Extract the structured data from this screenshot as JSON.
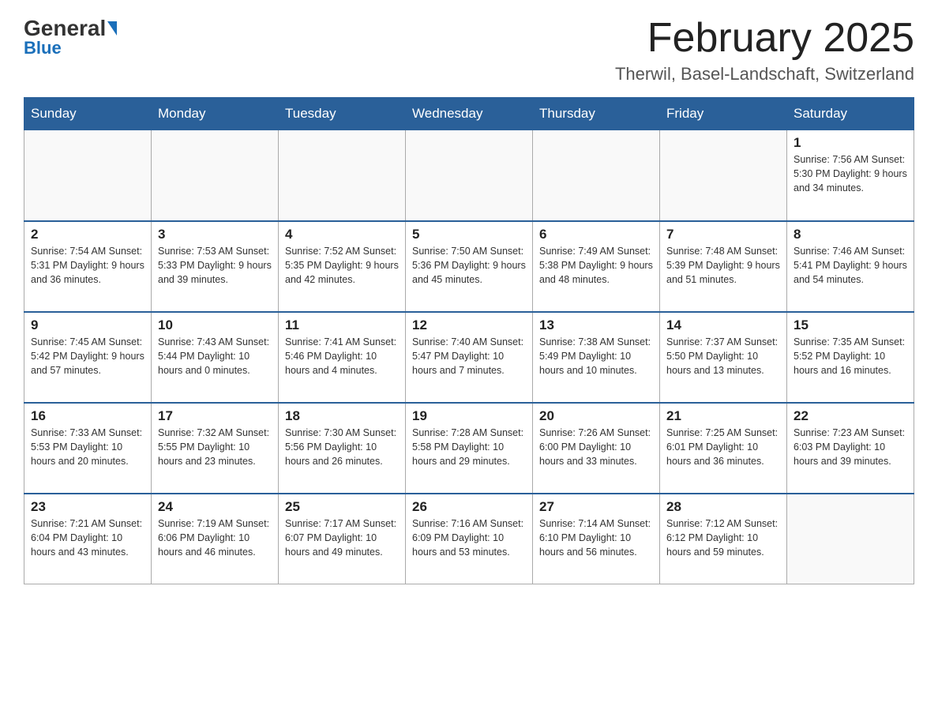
{
  "logo": {
    "general": "General",
    "blue": "Blue"
  },
  "title": "February 2025",
  "location": "Therwil, Basel-Landschaft, Switzerland",
  "headers": [
    "Sunday",
    "Monday",
    "Tuesday",
    "Wednesday",
    "Thursday",
    "Friday",
    "Saturday"
  ],
  "weeks": [
    [
      {
        "day": "",
        "info": ""
      },
      {
        "day": "",
        "info": ""
      },
      {
        "day": "",
        "info": ""
      },
      {
        "day": "",
        "info": ""
      },
      {
        "day": "",
        "info": ""
      },
      {
        "day": "",
        "info": ""
      },
      {
        "day": "1",
        "info": "Sunrise: 7:56 AM\nSunset: 5:30 PM\nDaylight: 9 hours and 34 minutes."
      }
    ],
    [
      {
        "day": "2",
        "info": "Sunrise: 7:54 AM\nSunset: 5:31 PM\nDaylight: 9 hours and 36 minutes."
      },
      {
        "day": "3",
        "info": "Sunrise: 7:53 AM\nSunset: 5:33 PM\nDaylight: 9 hours and 39 minutes."
      },
      {
        "day": "4",
        "info": "Sunrise: 7:52 AM\nSunset: 5:35 PM\nDaylight: 9 hours and 42 minutes."
      },
      {
        "day": "5",
        "info": "Sunrise: 7:50 AM\nSunset: 5:36 PM\nDaylight: 9 hours and 45 minutes."
      },
      {
        "day": "6",
        "info": "Sunrise: 7:49 AM\nSunset: 5:38 PM\nDaylight: 9 hours and 48 minutes."
      },
      {
        "day": "7",
        "info": "Sunrise: 7:48 AM\nSunset: 5:39 PM\nDaylight: 9 hours and 51 minutes."
      },
      {
        "day": "8",
        "info": "Sunrise: 7:46 AM\nSunset: 5:41 PM\nDaylight: 9 hours and 54 minutes."
      }
    ],
    [
      {
        "day": "9",
        "info": "Sunrise: 7:45 AM\nSunset: 5:42 PM\nDaylight: 9 hours and 57 minutes."
      },
      {
        "day": "10",
        "info": "Sunrise: 7:43 AM\nSunset: 5:44 PM\nDaylight: 10 hours and 0 minutes."
      },
      {
        "day": "11",
        "info": "Sunrise: 7:41 AM\nSunset: 5:46 PM\nDaylight: 10 hours and 4 minutes."
      },
      {
        "day": "12",
        "info": "Sunrise: 7:40 AM\nSunset: 5:47 PM\nDaylight: 10 hours and 7 minutes."
      },
      {
        "day": "13",
        "info": "Sunrise: 7:38 AM\nSunset: 5:49 PM\nDaylight: 10 hours and 10 minutes."
      },
      {
        "day": "14",
        "info": "Sunrise: 7:37 AM\nSunset: 5:50 PM\nDaylight: 10 hours and 13 minutes."
      },
      {
        "day": "15",
        "info": "Sunrise: 7:35 AM\nSunset: 5:52 PM\nDaylight: 10 hours and 16 minutes."
      }
    ],
    [
      {
        "day": "16",
        "info": "Sunrise: 7:33 AM\nSunset: 5:53 PM\nDaylight: 10 hours and 20 minutes."
      },
      {
        "day": "17",
        "info": "Sunrise: 7:32 AM\nSunset: 5:55 PM\nDaylight: 10 hours and 23 minutes."
      },
      {
        "day": "18",
        "info": "Sunrise: 7:30 AM\nSunset: 5:56 PM\nDaylight: 10 hours and 26 minutes."
      },
      {
        "day": "19",
        "info": "Sunrise: 7:28 AM\nSunset: 5:58 PM\nDaylight: 10 hours and 29 minutes."
      },
      {
        "day": "20",
        "info": "Sunrise: 7:26 AM\nSunset: 6:00 PM\nDaylight: 10 hours and 33 minutes."
      },
      {
        "day": "21",
        "info": "Sunrise: 7:25 AM\nSunset: 6:01 PM\nDaylight: 10 hours and 36 minutes."
      },
      {
        "day": "22",
        "info": "Sunrise: 7:23 AM\nSunset: 6:03 PM\nDaylight: 10 hours and 39 minutes."
      }
    ],
    [
      {
        "day": "23",
        "info": "Sunrise: 7:21 AM\nSunset: 6:04 PM\nDaylight: 10 hours and 43 minutes."
      },
      {
        "day": "24",
        "info": "Sunrise: 7:19 AM\nSunset: 6:06 PM\nDaylight: 10 hours and 46 minutes."
      },
      {
        "day": "25",
        "info": "Sunrise: 7:17 AM\nSunset: 6:07 PM\nDaylight: 10 hours and 49 minutes."
      },
      {
        "day": "26",
        "info": "Sunrise: 7:16 AM\nSunset: 6:09 PM\nDaylight: 10 hours and 53 minutes."
      },
      {
        "day": "27",
        "info": "Sunrise: 7:14 AM\nSunset: 6:10 PM\nDaylight: 10 hours and 56 minutes."
      },
      {
        "day": "28",
        "info": "Sunrise: 7:12 AM\nSunset: 6:12 PM\nDaylight: 10 hours and 59 minutes."
      },
      {
        "day": "",
        "info": ""
      }
    ]
  ]
}
